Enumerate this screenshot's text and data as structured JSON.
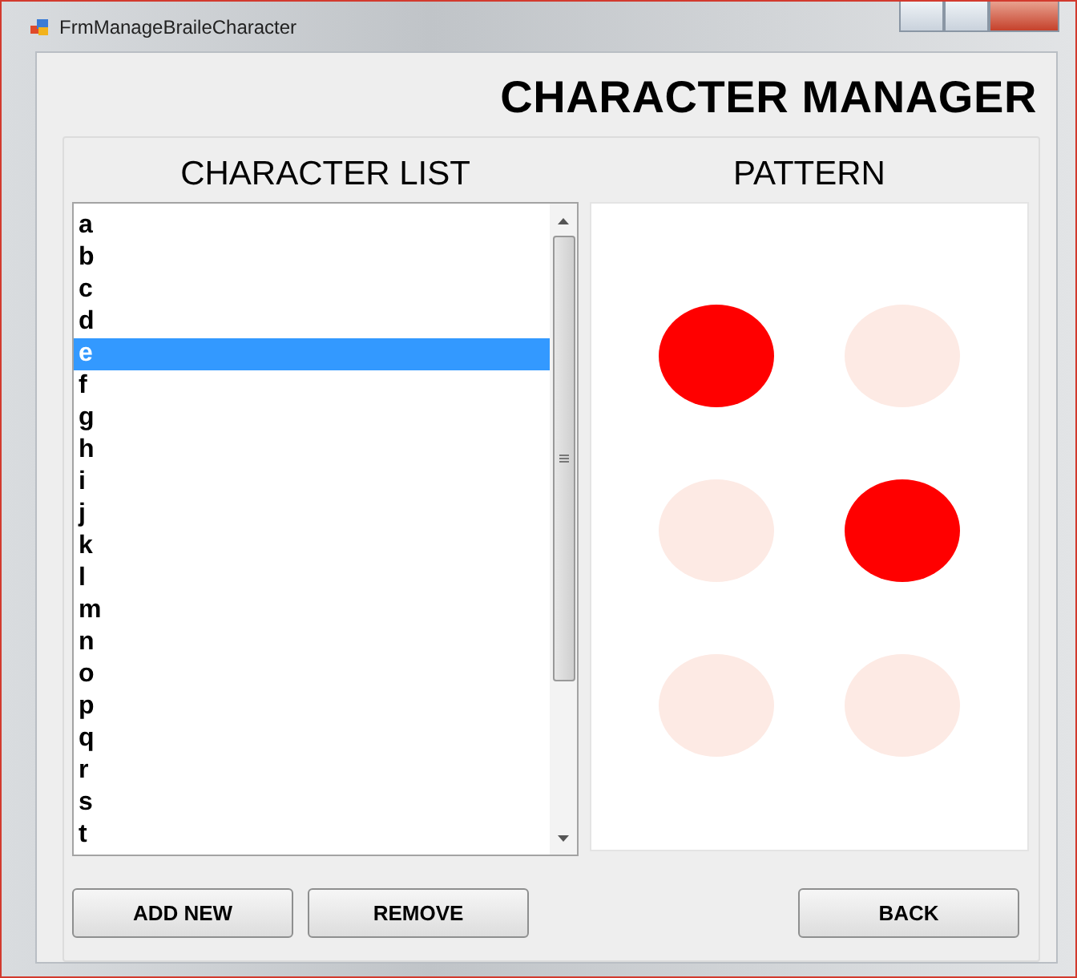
{
  "window": {
    "title": "FrmManageBraileCharacter"
  },
  "heading": "CHARACTER MANAGER",
  "character_list": {
    "label": "CHARACTER LIST",
    "items": [
      {
        "text": "a",
        "selected": false
      },
      {
        "text": "b",
        "selected": false
      },
      {
        "text": "c",
        "selected": false
      },
      {
        "text": "d",
        "selected": false
      },
      {
        "text": "e",
        "selected": true
      },
      {
        "text": "f",
        "selected": false
      },
      {
        "text": "g",
        "selected": false
      },
      {
        "text": "h",
        "selected": false
      },
      {
        "text": "i",
        "selected": false
      },
      {
        "text": "j",
        "selected": false
      },
      {
        "text": "k",
        "selected": false
      },
      {
        "text": "l",
        "selected": false
      },
      {
        "text": "m",
        "selected": false
      },
      {
        "text": "n",
        "selected": false
      },
      {
        "text": "o",
        "selected": false
      },
      {
        "text": "p",
        "selected": false
      },
      {
        "text": "q",
        "selected": false
      },
      {
        "text": "r",
        "selected": false
      },
      {
        "text": "s",
        "selected": false
      },
      {
        "text": "t",
        "selected": false
      }
    ]
  },
  "pattern": {
    "label": "PATTERN",
    "dots": [
      {
        "on": true
      },
      {
        "on": false
      },
      {
        "on": false
      },
      {
        "on": true
      },
      {
        "on": false
      },
      {
        "on": false
      }
    ]
  },
  "buttons": [
    {
      "label": "ADD NEW",
      "kind": "left"
    },
    {
      "label": "REMOVE",
      "kind": "left"
    },
    {
      "label": "BACK",
      "kind": "right"
    }
  ]
}
